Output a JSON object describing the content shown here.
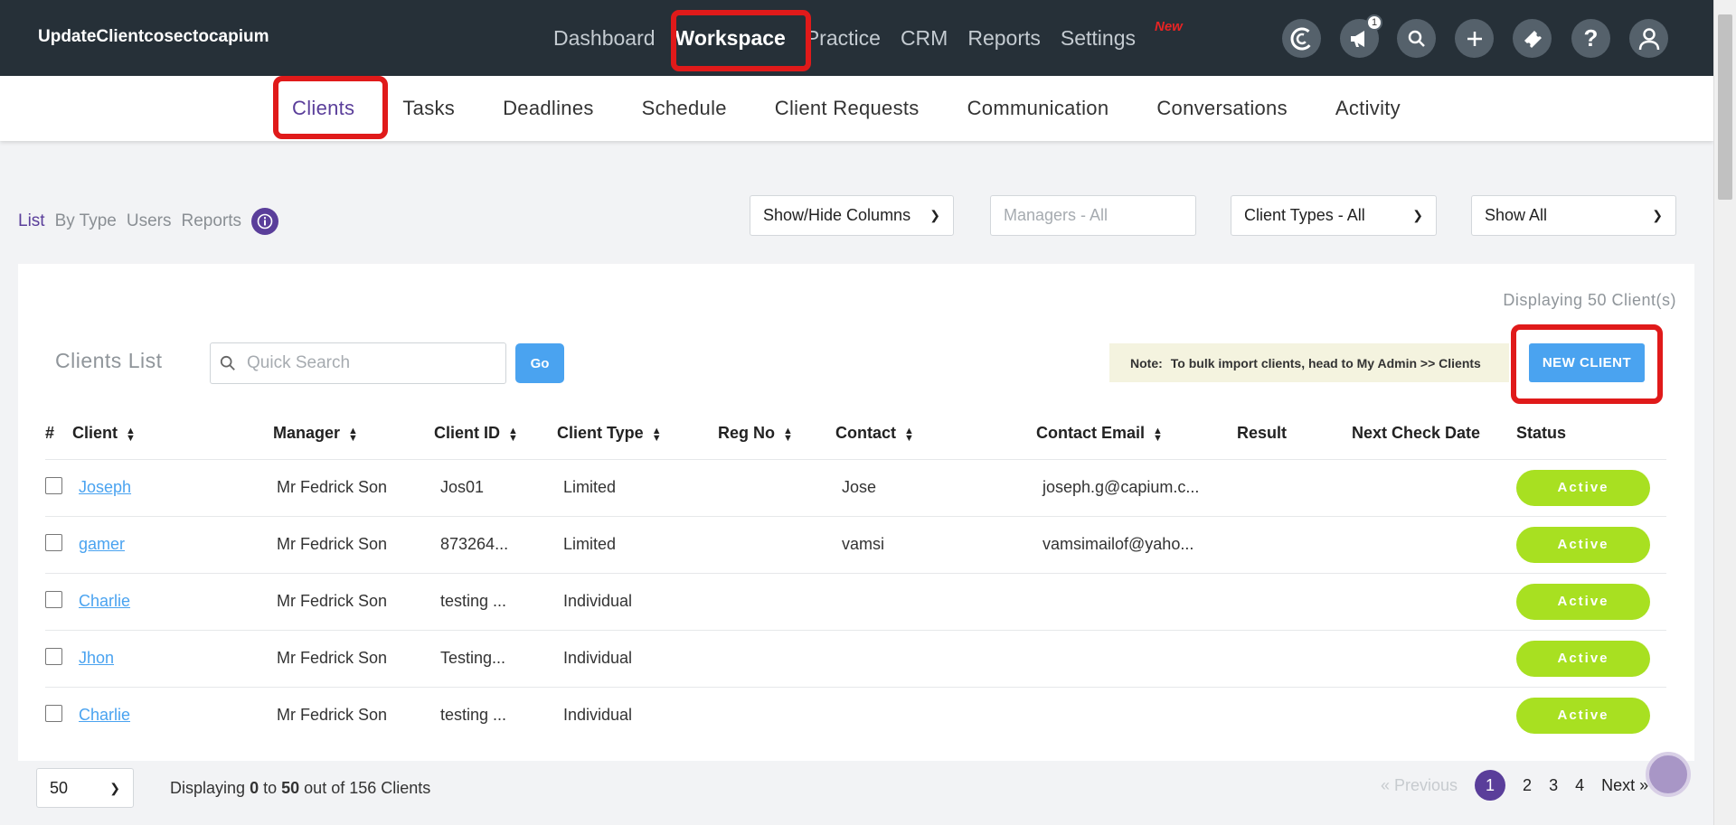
{
  "app": {
    "brand": "UpdateClientcosectocapium"
  },
  "top_nav": [
    {
      "label": "Dashboard"
    },
    {
      "label": "Workspace"
    },
    {
      "label": "Practice"
    },
    {
      "label": "CRM"
    },
    {
      "label": "Reports"
    },
    {
      "label": "Settings"
    }
  ],
  "new_badge": "New",
  "notifications_count": "1",
  "sub_nav": [
    {
      "label": "Clients"
    },
    {
      "label": "Tasks"
    },
    {
      "label": "Deadlines"
    },
    {
      "label": "Schedule"
    },
    {
      "label": "Client Requests"
    },
    {
      "label": "Communication"
    },
    {
      "label": "Conversations"
    },
    {
      "label": "Activity"
    }
  ],
  "views": {
    "list": "List",
    "by_type": "By Type",
    "users": "Users",
    "reports": "Reports"
  },
  "filters": {
    "columns": "Show/Hide Columns",
    "managers_placeholder": "Managers - All",
    "client_types": "Client Types - All",
    "show": "Show All"
  },
  "card": {
    "displaying": "Displaying 50 Client(s)",
    "title": "Clients List",
    "search_placeholder": "Quick Search",
    "go": "Go",
    "note_label": "Note:",
    "note_text": "To bulk import clients, head to My Admin >> Clients",
    "new_client": "NEW CLIENT"
  },
  "table": {
    "headers": {
      "num": "#",
      "client": "Client",
      "manager": "Manager",
      "client_id": "Client ID",
      "client_type": "Client Type",
      "reg_no": "Reg No",
      "contact": "Contact",
      "contact_email": "Contact Email",
      "result": "Result",
      "next_check": "Next Check Date",
      "status": "Status"
    },
    "rows": [
      {
        "client": "Joseph",
        "manager": "Mr Fedrick Son",
        "client_id": "Jos01",
        "client_type": "Limited",
        "reg_no": "",
        "contact": "Jose",
        "email": "joseph.g@capium.c...",
        "result": "",
        "next_check": "",
        "status": "Active"
      },
      {
        "client": "gamer",
        "manager": "Mr Fedrick Son",
        "client_id": "873264...",
        "client_type": "Limited",
        "reg_no": "",
        "contact": "vamsi",
        "email": "vamsimailof@yaho...",
        "result": "",
        "next_check": "",
        "status": "Active"
      },
      {
        "client": "Charlie",
        "manager": "Mr Fedrick Son",
        "client_id": "testing ...",
        "client_type": "Individual",
        "reg_no": "",
        "contact": "",
        "email": "",
        "result": "",
        "next_check": "",
        "status": "Active"
      },
      {
        "client": "Jhon",
        "manager": "Mr Fedrick Son",
        "client_id": "Testing...",
        "client_type": "Individual",
        "reg_no": "",
        "contact": "",
        "email": "",
        "result": "",
        "next_check": "",
        "status": "Active"
      },
      {
        "client": "Charlie",
        "manager": "Mr Fedrick Son",
        "client_id": "testing ...",
        "client_type": "Individual",
        "reg_no": "",
        "contact": "",
        "email": "",
        "result": "",
        "next_check": "",
        "status": "Active"
      }
    ]
  },
  "footer": {
    "per_page": "50",
    "text_prefix": "Displaying",
    "from": "0",
    "to_word": "to",
    "to": "50",
    "text_suffix": "out of 156 Clients",
    "prev": "« Previous",
    "pages": [
      "1",
      "2",
      "3",
      "4"
    ],
    "next": "Next »"
  },
  "colors": {
    "navbar": "#263038",
    "accent": "#5a3e9a",
    "button": "#4aa3f0",
    "status": "#a8e021",
    "highlight": "#e01a1a"
  }
}
